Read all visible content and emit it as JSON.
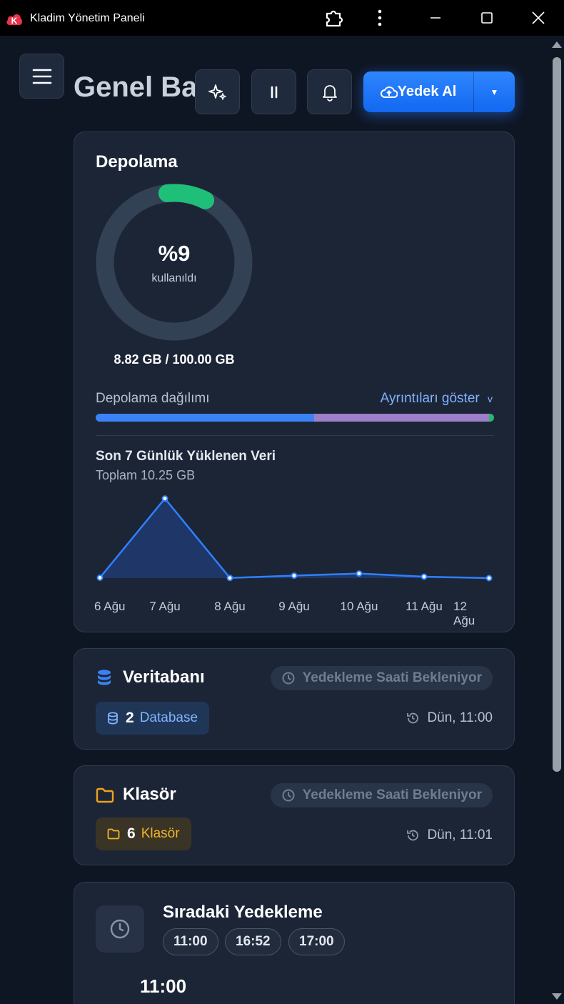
{
  "window": {
    "title": "Kladim Yönetim Paneli",
    "logo_letter": "K"
  },
  "header": {
    "page_title": "Genel Ba",
    "backup_button_label": "Yedek Al",
    "backup_dropdown_glyph": "▼"
  },
  "storage": {
    "title": "Depolama",
    "percent_label": "%9",
    "percent_value": 9,
    "percent_sub": "kullanıldı",
    "usage": "8.82 GB / 100.00 GB",
    "distribution_label": "Depolama dağılımı",
    "details_link": "Ayrıntıları göster",
    "details_glyph": "v",
    "distribution_segments": [
      {
        "color": "#3b82f6",
        "fraction": 0.548
      },
      {
        "color": "#9b7fc8",
        "fraction": 0.44
      },
      {
        "color": "#2bb673",
        "fraction": 0.012
      }
    ],
    "accent_color": "#1fbf7a"
  },
  "chart_data": {
    "type": "area",
    "title": "Son 7 Günlük Yüklenen Veri",
    "subtitle": "Toplam 10.25 GB",
    "categories": [
      "6 Ağu",
      "7 Ağu",
      "8 Ağu",
      "9 Ağu",
      "10 Ağu",
      "11 Ağu",
      "12 Ağu"
    ],
    "values": [
      0.05,
      9.6,
      0.02,
      0.3,
      0.55,
      0.17,
      0.0
    ],
    "ylim": [
      0,
      10
    ],
    "grid": false,
    "legend": "none",
    "color": "#2f80ff"
  },
  "database_card": {
    "title": "Veritabanı",
    "status": "Yedekleme Saati Bekleniyor",
    "count": "2",
    "count_label": "Database",
    "last_time": "Dün, 11:00"
  },
  "folder_card": {
    "title": "Klasör",
    "status": "Yedekleme Saati Bekleniyor",
    "count": "6",
    "count_label": "Klasör",
    "last_time": "Dün, 11:01"
  },
  "next_backup": {
    "title": "Sıradaki Yedekleme",
    "times": [
      "11:00",
      "16:52",
      "17:00"
    ],
    "big_time": "11:00"
  }
}
